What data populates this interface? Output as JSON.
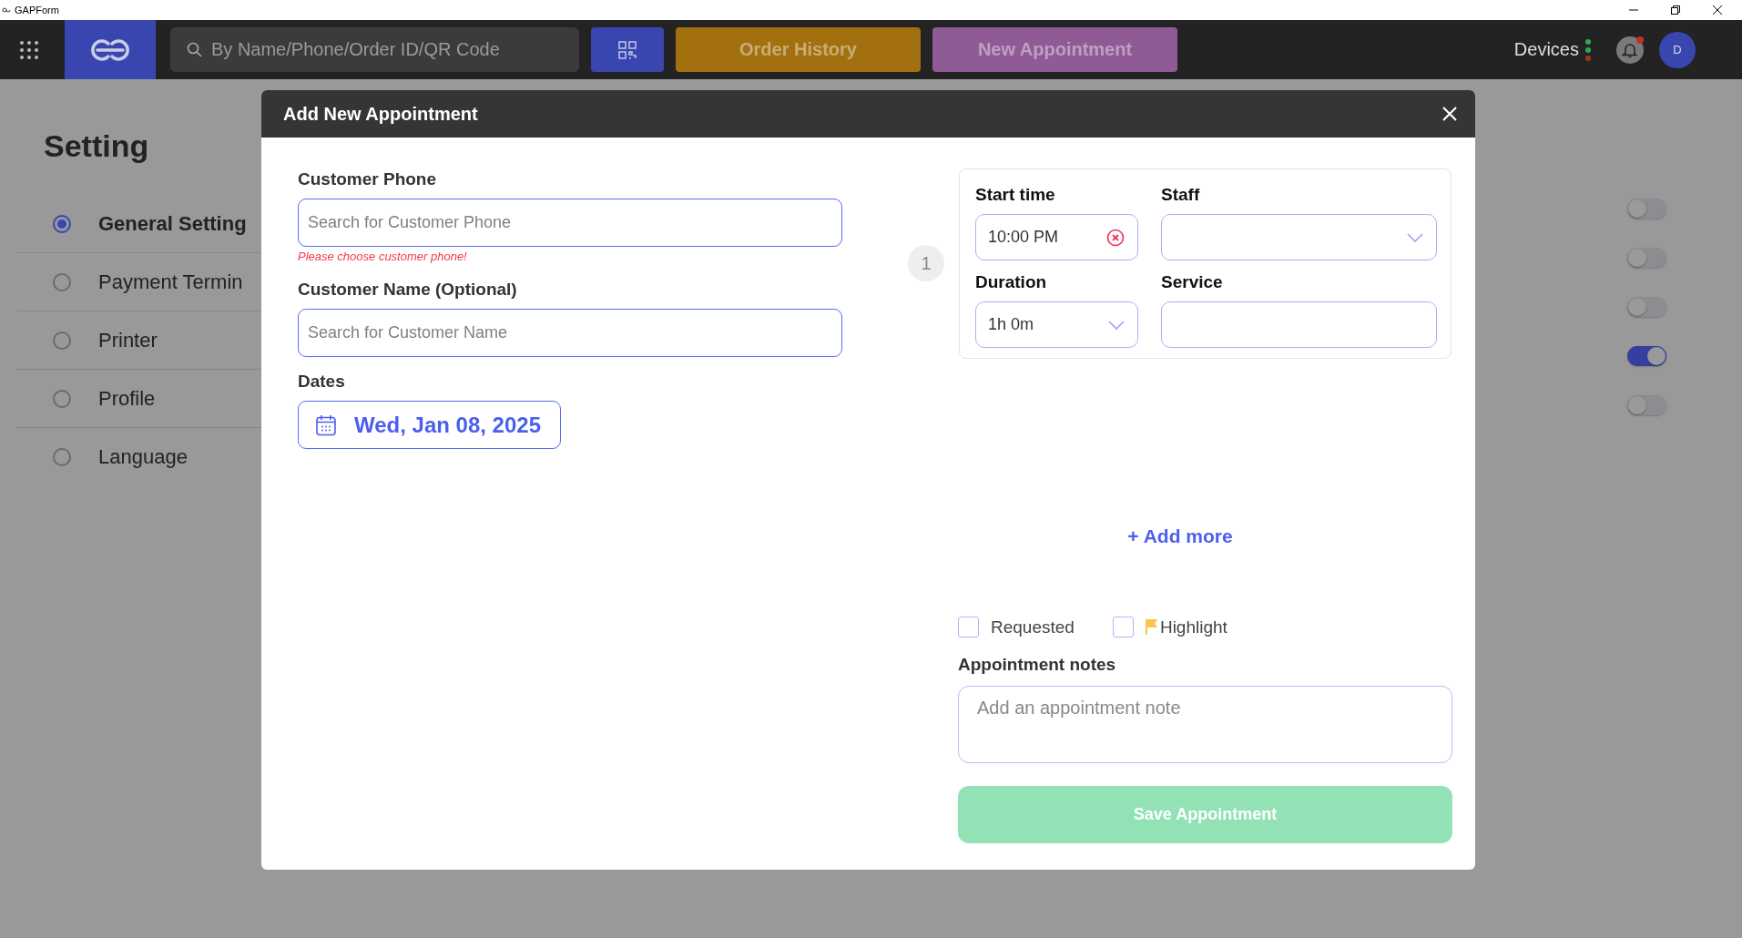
{
  "window": {
    "title": "GAPForm"
  },
  "top_bar": {
    "search": {
      "placeholder": "By Name/Phone/Order ID/QR Code"
    },
    "buttons": [
      {
        "label": "Order History",
        "color": "#a2700f"
      },
      {
        "label": "New Appointment",
        "color": "#8f5a96"
      }
    ],
    "devices": {
      "label": "Devices",
      "dots": [
        {
          "color": "#2fa84f"
        },
        {
          "color": "#2fa84f"
        },
        {
          "color": "#a8341f"
        }
      ]
    },
    "notifications": {
      "unread": true
    },
    "avatar": "D"
  },
  "sidebar": {
    "title": "Setting",
    "items": [
      {
        "label": "General Setting",
        "selected": true
      },
      {
        "label": "Payment Termin",
        "selected": false
      },
      {
        "label": "Printer",
        "selected": false
      },
      {
        "label": "Profile",
        "selected": false
      },
      {
        "label": "Language",
        "selected": false
      }
    ]
  },
  "toggles": [
    {
      "on": false
    },
    {
      "on": false
    },
    {
      "on": false
    },
    {
      "on": true
    },
    {
      "on": false
    }
  ],
  "modal": {
    "title": "Add New Appointment",
    "customer_phone": {
      "label": "Customer Phone",
      "placeholder": "Search for Customer Phone",
      "error": "Please choose customer phone!"
    },
    "customer_name": {
      "label": "Customer Name (Optional)",
      "placeholder": "Search for Customer Name"
    },
    "dates": {
      "label": "Dates",
      "value": "Wed, Jan 08, 2025"
    },
    "appointments": [
      {
        "number": "1",
        "start_time": {
          "label": "Start time",
          "value": "10:00 PM"
        },
        "staff": {
          "label": "Staff"
        },
        "duration": {
          "label": "Duration",
          "value": "1h 0m"
        },
        "service": {
          "label": "Service"
        }
      }
    ],
    "add_more": "+ Add more",
    "options": [
      {
        "kind": "plain",
        "label": "Requested",
        "checked": false
      },
      {
        "kind": "flag",
        "label": "Highlight",
        "checked": false
      }
    ],
    "notes": {
      "label": "Appointment notes",
      "placeholder": "Add an appointment note"
    },
    "save_button": {
      "label": "Save Appointment",
      "disabled": true
    }
  }
}
